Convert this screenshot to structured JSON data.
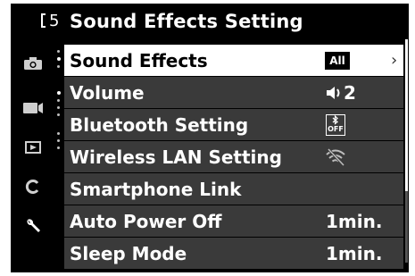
{
  "header": {
    "page_number": "5",
    "title": "Sound Effects Setting"
  },
  "sidebar": {
    "icons": [
      "camera-icon",
      "video-camera-icon",
      "playback-icon",
      "custom-c-icon",
      "wrench-icon"
    ]
  },
  "menu": {
    "items": [
      {
        "label": "Sound Effects",
        "value": "All",
        "selected": true
      },
      {
        "label": "Volume",
        "value": "2",
        "icon": "speaker-icon"
      },
      {
        "label": "Bluetooth Setting",
        "value": "OFF",
        "icon": "bluetooth-icon"
      },
      {
        "label": "Wireless LAN Setting",
        "value": "",
        "icon": "wifi-off-icon"
      },
      {
        "label": "Smartphone Link",
        "value": ""
      },
      {
        "label": "Auto Power Off",
        "value": "1min."
      },
      {
        "label": "Sleep Mode",
        "value": "1min."
      }
    ]
  },
  "colors": {
    "background": "#000000",
    "row": "#3a3a3a",
    "selected_row": "#ffffff",
    "text": "#ffffff"
  }
}
